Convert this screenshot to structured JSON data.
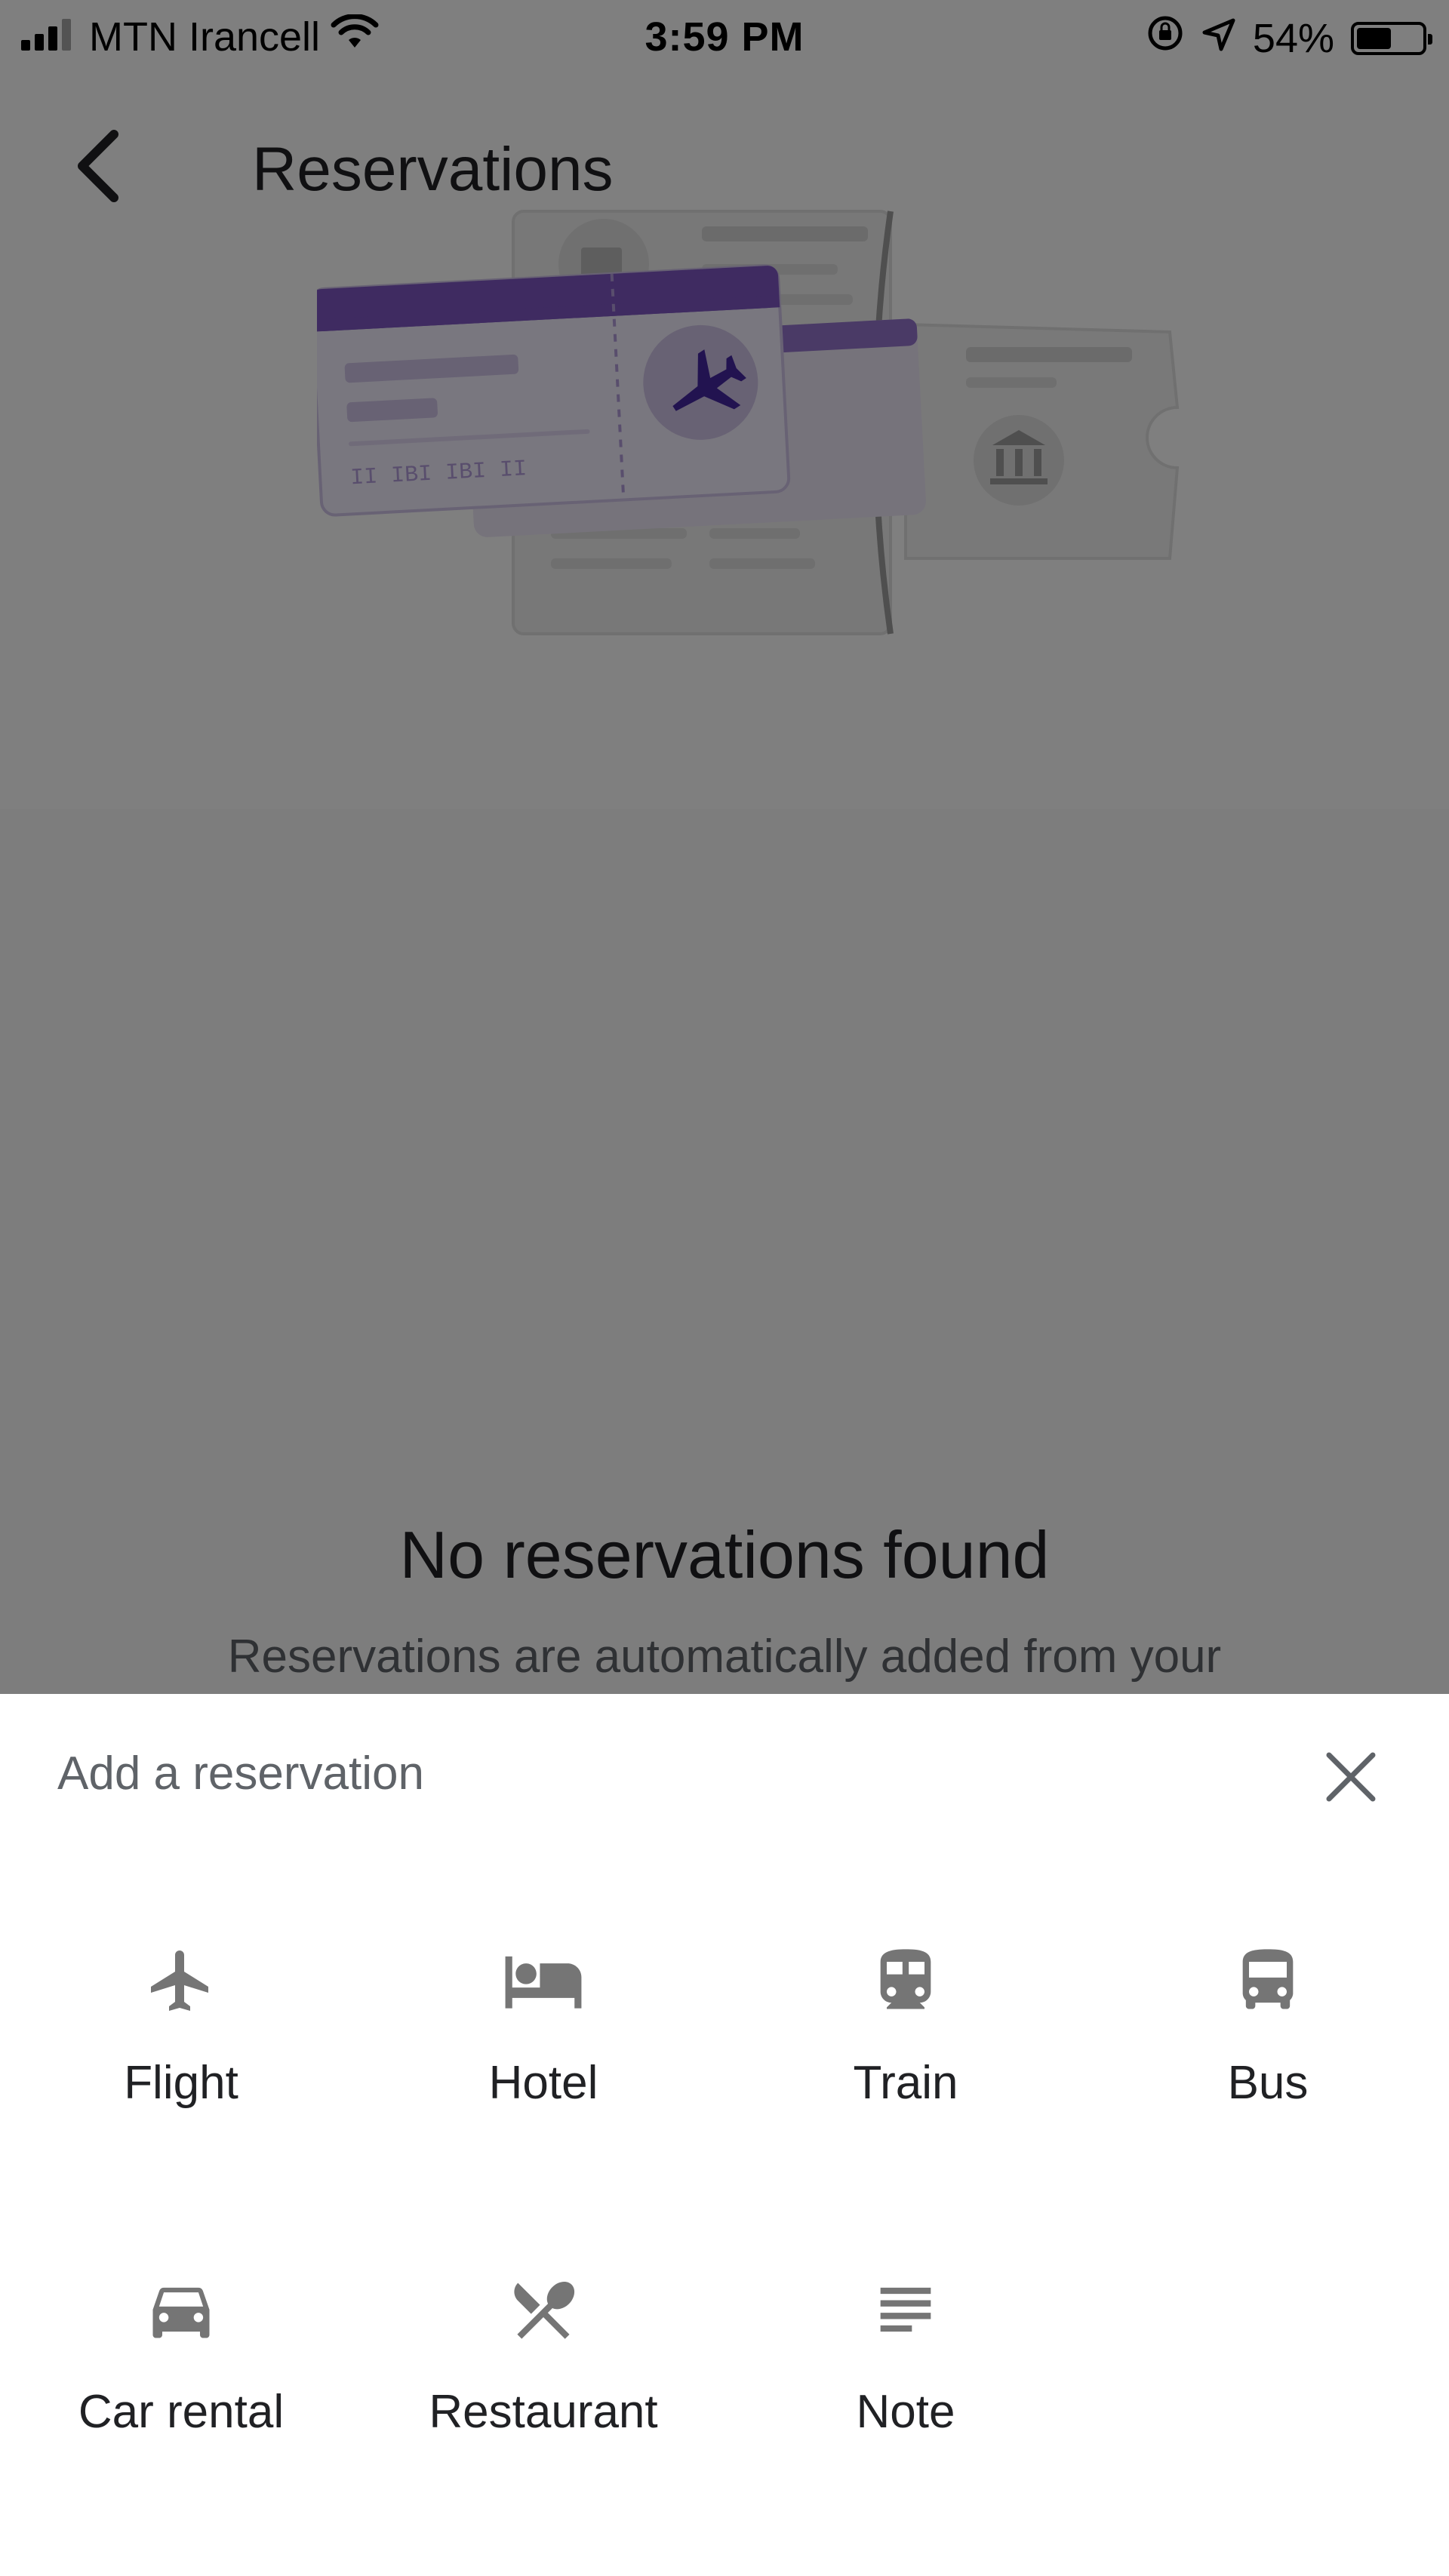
{
  "status_bar": {
    "carrier": "MTN Irancell",
    "time": "3:59 PM",
    "battery_percent_text": "54%",
    "battery_level": 0.54
  },
  "header": {
    "title": "Reservations"
  },
  "empty_state": {
    "title": "No reservations found",
    "description": "Reservations are automatically added from your"
  },
  "sheet": {
    "title": "Add a reservation",
    "options": [
      {
        "label": "Flight",
        "icon": "airplane-icon"
      },
      {
        "label": "Hotel",
        "icon": "bed-icon"
      },
      {
        "label": "Train",
        "icon": "train-icon"
      },
      {
        "label": "Bus",
        "icon": "bus-icon"
      },
      {
        "label": "Car rental",
        "icon": "car-icon"
      },
      {
        "label": "Restaurant",
        "icon": "restaurant-icon"
      },
      {
        "label": "Note",
        "icon": "note-icon"
      }
    ]
  },
  "colors": {
    "accent": "#7e57c2",
    "accent_light": "#d1c4e9",
    "icon_gray": "#757575",
    "scrim": "#000000"
  }
}
